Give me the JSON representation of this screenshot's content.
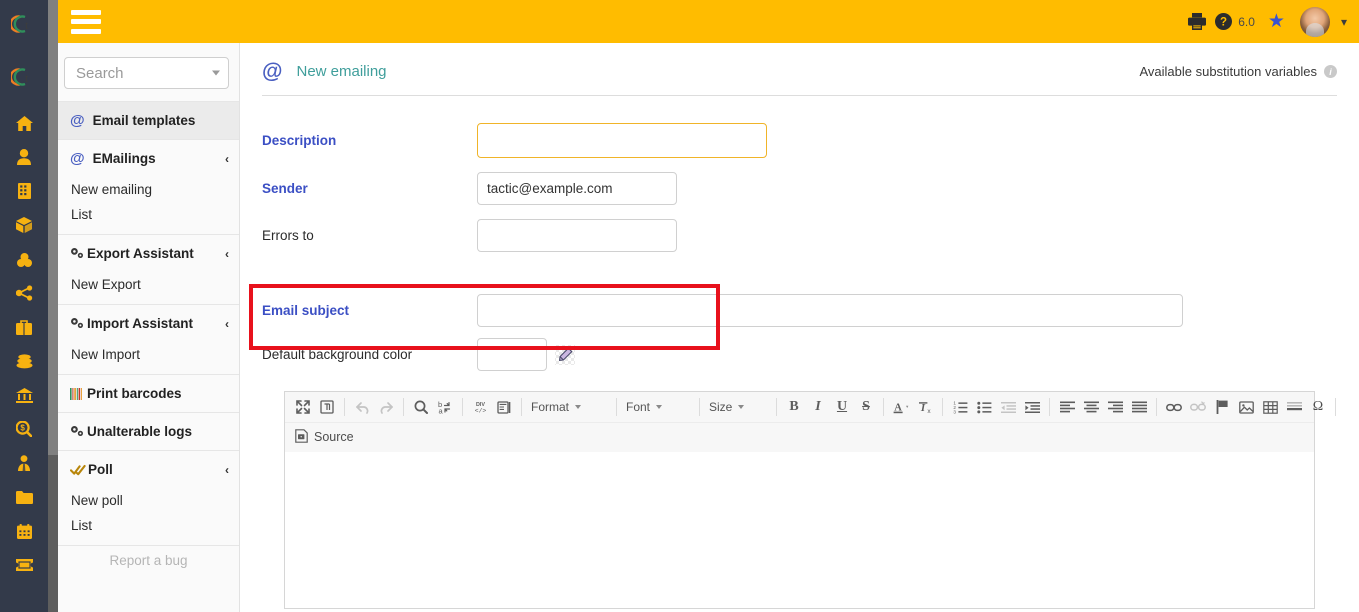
{
  "brand": {
    "accent_yellow": "#ffbc00",
    "rail_bg": "#333a4a",
    "icon_gold": "#f7b211",
    "annotation_red": "#e8111c",
    "link_blue": "#3b4fc4",
    "title_teal": "#3f9e9b"
  },
  "topbar": {
    "hamburger": "menu-icon",
    "print_icon": "print-icon",
    "help_icon": "help-icon",
    "version": "6.0",
    "star_icon": "star-icon",
    "avatar": "user-avatar",
    "chevron": "chevron-down-icon"
  },
  "rail": {
    "logo": "tactic-logo",
    "items": [
      {
        "name": "home-icon"
      },
      {
        "name": "user-icon"
      },
      {
        "name": "building-icon"
      },
      {
        "name": "box-icon"
      },
      {
        "name": "boxes-icon"
      },
      {
        "name": "sitemap-icon"
      },
      {
        "name": "briefcase-icon"
      },
      {
        "name": "coins-icon"
      },
      {
        "name": "bank-icon"
      },
      {
        "name": "search-money-icon"
      },
      {
        "name": "user-tie-icon"
      },
      {
        "name": "folder-icon"
      },
      {
        "name": "calendar-icon"
      },
      {
        "name": "ticket-icon"
      }
    ]
  },
  "search": {
    "placeholder": "Search",
    "value": ""
  },
  "sidebar": {
    "groups": [
      {
        "label": "Email templates",
        "icon": "at-icon",
        "active": true,
        "collapsible": false,
        "items": []
      },
      {
        "label": "EMailings",
        "icon": "at-icon",
        "active": false,
        "collapsible": true,
        "chevron": "‹",
        "items": [
          "New emailing",
          "List"
        ]
      },
      {
        "label": "Export Assistant",
        "icon": "gears-icon",
        "active": false,
        "collapsible": true,
        "chevron": "‹",
        "items": [
          "New Export"
        ]
      },
      {
        "label": "Import Assistant",
        "icon": "gears-icon",
        "active": false,
        "collapsible": true,
        "chevron": "‹",
        "items": [
          "New Import"
        ]
      },
      {
        "label": "Print barcodes",
        "icon": "barcode-icon",
        "active": false,
        "collapsible": false,
        "items": []
      },
      {
        "label": "Unalterable logs",
        "icon": "gears-icon",
        "active": false,
        "collapsible": false,
        "items": []
      },
      {
        "label": "Poll",
        "icon": "double-check-icon",
        "active": false,
        "collapsible": true,
        "chevron": "‹",
        "items": [
          "New poll",
          "List"
        ]
      }
    ],
    "report_bug": "Report a bug"
  },
  "page": {
    "icon": "at-icon",
    "title": "New emailing",
    "substitution_link": "Available substitution variables",
    "info_icon": "info-icon"
  },
  "form": {
    "description": {
      "label": "Description",
      "value": "",
      "focused": true
    },
    "sender": {
      "label": "Sender",
      "value": "tactic@example.com"
    },
    "errors_to": {
      "label": "Errors to",
      "value": ""
    },
    "email_subject": {
      "label": "Email subject",
      "value": ""
    },
    "background_color": {
      "label": "Default background color",
      "value": "",
      "picker_icon": "color-picker-icon"
    }
  },
  "editor": {
    "row1": [
      {
        "name": "maximize-icon",
        "type": "icon",
        "kind": "maximize",
        "disabled": false
      },
      {
        "name": "show-blocks-icon",
        "type": "icon",
        "kind": "showblocks",
        "disabled": false
      },
      {
        "type": "sep"
      },
      {
        "name": "undo-icon",
        "type": "icon",
        "kind": "undo",
        "disabled": true
      },
      {
        "name": "redo-icon",
        "type": "icon",
        "kind": "redo",
        "disabled": true
      },
      {
        "type": "sep"
      },
      {
        "name": "find-icon",
        "type": "icon",
        "kind": "find",
        "disabled": false
      },
      {
        "name": "replace-icon",
        "type": "icon",
        "kind": "replace",
        "disabled": false
      },
      {
        "type": "sep"
      },
      {
        "name": "create-div-icon",
        "type": "icon",
        "kind": "div",
        "disabled": false
      },
      {
        "name": "templates-icon",
        "type": "icon",
        "kind": "templates",
        "disabled": false
      },
      {
        "type": "sep"
      },
      {
        "name": "format-dropdown",
        "type": "combo",
        "cls": "format",
        "label": "Format"
      },
      {
        "type": "sep"
      },
      {
        "name": "font-dropdown",
        "type": "combo",
        "cls": "font",
        "label": "Font"
      },
      {
        "type": "sep"
      },
      {
        "name": "size-dropdown",
        "type": "combo",
        "cls": "size",
        "label": "Size"
      },
      {
        "type": "sep"
      },
      {
        "name": "bold-button",
        "type": "letter",
        "cls": "",
        "label": "B"
      },
      {
        "name": "italic-button",
        "type": "letter",
        "cls": "i",
        "label": "I"
      },
      {
        "name": "underline-button",
        "type": "letter",
        "cls": "u",
        "label": "U"
      },
      {
        "name": "strikethrough-button",
        "type": "letter",
        "cls": "s",
        "label": "S"
      },
      {
        "type": "sep"
      },
      {
        "name": "text-color-icon",
        "type": "icon",
        "kind": "textcolor",
        "disabled": false
      },
      {
        "name": "remove-format-icon",
        "type": "icon",
        "kind": "removeformat",
        "disabled": false
      },
      {
        "type": "sep"
      },
      {
        "name": "numbered-list-icon",
        "type": "icon",
        "kind": "numlist",
        "disabled": false
      },
      {
        "name": "bulleted-list-icon",
        "type": "icon",
        "kind": "bullist",
        "disabled": false
      },
      {
        "name": "outdent-icon",
        "type": "icon",
        "kind": "outdent",
        "disabled": true
      },
      {
        "name": "indent-icon",
        "type": "icon",
        "kind": "indent",
        "disabled": false
      },
      {
        "type": "sep"
      },
      {
        "name": "align-left-icon",
        "type": "icon",
        "kind": "alignleft",
        "disabled": false
      },
      {
        "name": "align-center-icon",
        "type": "icon",
        "kind": "aligncenter",
        "disabled": false
      },
      {
        "name": "align-right-icon",
        "type": "icon",
        "kind": "alignright",
        "disabled": false
      },
      {
        "name": "align-justify-icon",
        "type": "icon",
        "kind": "alignjustify",
        "disabled": false
      },
      {
        "type": "sep"
      },
      {
        "name": "link-icon",
        "type": "icon",
        "kind": "link",
        "disabled": false
      },
      {
        "name": "unlink-icon",
        "type": "icon",
        "kind": "unlink",
        "disabled": true
      },
      {
        "name": "anchor-icon",
        "type": "icon",
        "kind": "anchor",
        "disabled": false
      },
      {
        "name": "image-icon",
        "type": "icon",
        "kind": "image",
        "disabled": false
      },
      {
        "name": "table-icon",
        "type": "icon",
        "kind": "table",
        "disabled": false
      },
      {
        "name": "horizontal-rule-icon",
        "type": "icon",
        "kind": "hrule",
        "disabled": false
      },
      {
        "name": "special-char-icon",
        "type": "icon",
        "kind": "omega",
        "disabled": false
      },
      {
        "type": "sep"
      }
    ],
    "source_label": "Source",
    "source_icon": "source-icon",
    "content": ""
  },
  "annotation": {
    "shape": "rectangle",
    "color": "#e8111c",
    "targets": "errors-to-field"
  }
}
